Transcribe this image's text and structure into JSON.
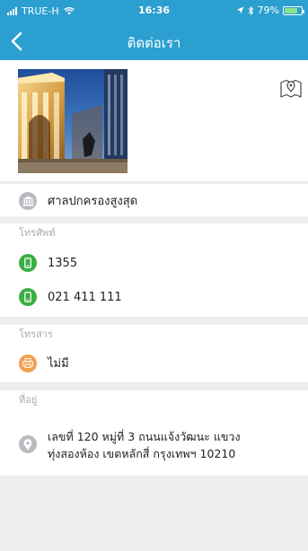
{
  "status_bar": {
    "carrier": "TRUE-H",
    "time": "16:36",
    "battery_percent": "79%",
    "battery_level": 0.79
  },
  "nav": {
    "title": "ติดต่อเรา"
  },
  "organization": {
    "name": "ศาลปกครองสูงสุด",
    "icon": "courthouse-icon"
  },
  "phone_section": {
    "label": "โทรศัพท์",
    "numbers": [
      "1355",
      "021 411 111"
    ],
    "icon": "phone-icon"
  },
  "fax_section": {
    "label": "โทรสาร",
    "value": "ไม่มี",
    "icon": "fax-icon"
  },
  "address_section": {
    "label": "ที่อยู่",
    "line1": "เลขที่ 120 หมู่ที่ 3 ถนนแจ้งวัฒนะ แขวง",
    "line2": "ทุ่งสองห้อง เขตหลักสี่ กรุงเทพฯ 10210",
    "icon": "map-pin-icon"
  },
  "colors": {
    "header": "#2b9fd0",
    "green": "#3cae45",
    "orange": "#f0a050",
    "gray_icon": "#b8bcc0",
    "background": "#eceef0"
  }
}
